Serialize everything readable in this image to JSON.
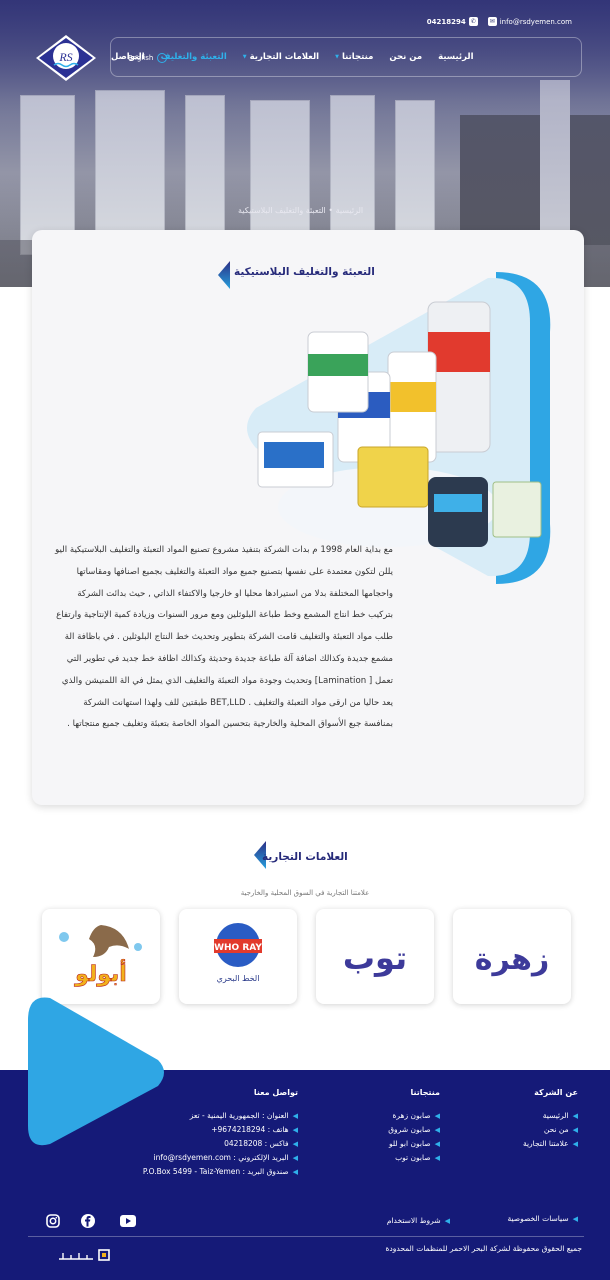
{
  "topbar": {
    "phone": "04218294",
    "email": "info@rsdyemen.com"
  },
  "logo": {
    "letters": "RS"
  },
  "nav": {
    "items": [
      "الرئيسية",
      "من نحن",
      "منتجاتنا",
      "العلامات التجارية",
      "التعبئة والتغليف",
      "التواصل"
    ],
    "language": "English"
  },
  "breadcrumb": "الرئيسية • التعبئة والتغليف البلاستيكية",
  "packaging": {
    "title": "التعبئة والتغليف البلاستيكية",
    "body": "مع بداية العام 1998 م بدات الشركة بتنفيذ مشروع تصنيع المواد التعبئة والتغليف البلاستيكية اليو يللن لتكون معتمدة على نفسها بتصنيع جميع مواد التعبئة والتغليف بجميع اصنافها ومقاساتها واحجامها المختلفة بدلا من استيرادها محليا او خارجيا والاكتفاء الذاتي , حيث بدائت الشركة بتركيب خط انتاج المشمع وخط طباعة البلوثلين ومع مرور السنوات وزيادة كمية الإنتاجية وارتفاع طلب مواد التعبئة والتغليف قامت الشركة بتطوير وتحديث خط النتاج البلوثلين . في باظافة الة مشمع جديدة وكذالك اضافة آلة طباعة جديدة وحديثة وكذالك اظافة خط جديد في تطوير التي تعمل [ Lamination] وتحديث وجودة مواد التعبئة والتغليف الذي يمثل في الة اللمنيشن والذي يعد حاليا من ارقى مواد التعبئة والتغليف . BET,LLD طبقتين للف ولهذا استهانت الشركة بمنافسة جبع الأسواق المحلية والخارجية بتحسين المواد الخاصة بتعبئة وتغليف جميع منتجاتها ."
  },
  "brands": {
    "title": "العلامات التجارية",
    "subtitle": "علامتنا التجارية في السوق المحلية والخارجية",
    "items": [
      {
        "name": "زهرة"
      },
      {
        "name": "توب"
      },
      {
        "name": "WHO RAY",
        "caption": "الخط البحري"
      },
      {
        "name": "أبولو"
      }
    ]
  },
  "footer": {
    "company": {
      "title": "عن الشركة",
      "links": [
        "الرئيسية",
        "من نحن",
        "علامتنا التجارية"
      ]
    },
    "products": {
      "title": "منتجاتنا",
      "links": [
        "صابون زهرة",
        "صابون شروق",
        "صابون ابو للو",
        "صابون توب"
      ]
    },
    "contact": {
      "title": "تواصل معنا",
      "lines": [
        "العنوان : الجمهورية اليمنية - تعز",
        "هاتف : 9674218294+",
        "فاكس : 04218208",
        "البريد الإلكتروني : info@rsdyemen.com",
        "صندوق البريد : P.O.Box 5499 - Taiz-Yemen"
      ]
    },
    "privacy": "سياسات الخصوصية",
    "terms": "شروط الاستخدام",
    "copyright": "جميع الحقوق محفوظة لشركة البحر الاحمر للمنظمات المحدودة"
  },
  "colors": {
    "navy": "#151a78",
    "accent": "#2fb0ea",
    "title": "#262a7a"
  }
}
